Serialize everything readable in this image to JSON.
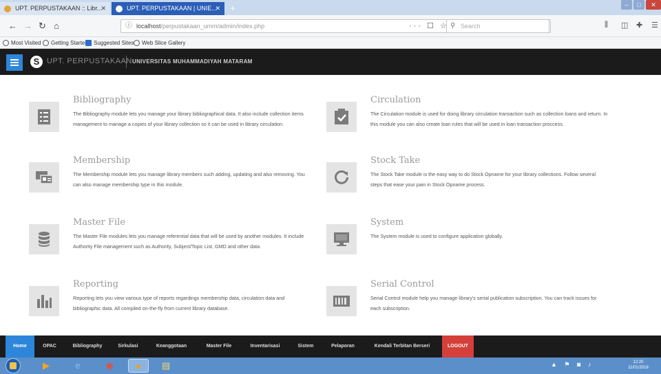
{
  "browser": {
    "tabs": [
      {
        "title": "UPT. PERPUSTAKAAN :: Libr...",
        "active": false
      },
      {
        "title": "UPT. PERPUSTAKAAN | UNIE...",
        "active": true
      }
    ],
    "url_host": "localhost",
    "url_path": "/perpustakaan_umm/admin/index.php",
    "search_placeholder": "Search",
    "bookmarks": [
      "Most Visited",
      "Getting Started",
      "Suggested Sites",
      "Web Slice Gallery"
    ]
  },
  "app": {
    "name": "UPT. PERPUSTAKAAN",
    "subtitle": "UNIVERSITAS MUHAMMADIYAH MATARAM",
    "accent_color": "#2d86d9",
    "logout_color": "#d43f3a"
  },
  "modules": [
    {
      "icon": "bibliography-icon",
      "title": "Bibliography",
      "description": "The Bibliography module lets you manage your library bibliographical data. It also include collection items management to manage a copies of your library collection so it can be used in library circulation."
    },
    {
      "icon": "circulation-icon",
      "title": "Circulation",
      "description": "The Circulation module is used for doing library circulation transaction such as collection loans and return. In this module you can also create loan rules that will be used in loan transaction proccess."
    },
    {
      "icon": "membership-icon",
      "title": "Membership",
      "description": "The Membership module lets you manage library members such adding, updating and also removing. You can also manage membership type in this module."
    },
    {
      "icon": "stock-take-icon",
      "title": "Stock Take",
      "description": "The Stock Take module is the easy way to do Stock Opname for your library collections. Follow several steps that ease your pain in Stock Opname process."
    },
    {
      "icon": "master-file-icon",
      "title": "Master File",
      "description": "The Master File modules lets you manage referential data that will be used by another modules. It include Authority File management such as Authority, Subject/Topic List, GMD and other data."
    },
    {
      "icon": "system-icon",
      "title": "System",
      "description": "The System module is used to configure application globally."
    },
    {
      "icon": "reporting-icon",
      "title": "Reporting",
      "description": "Reporting lets you view various type of reports regardings membership data, circulation data and bibliographic data. All compiled on-the-fly from current library database."
    },
    {
      "icon": "serial-control-icon",
      "title": "Serial Control",
      "description": "Serial Control module help you manage library's serial publication subscription. You can track issues for each subscription."
    }
  ],
  "bottom_menu": [
    "Home",
    "OPAC",
    "Bibliography",
    "Sirkulasi",
    "Keanggotaan",
    "Master File",
    "Inventarisasi",
    "Sistem",
    "Pelaporan",
    "Kendali Terbitan Berseri",
    "LOGOUT"
  ],
  "taskbar": {
    "time": "12:20",
    "date": "11/01/2018"
  }
}
